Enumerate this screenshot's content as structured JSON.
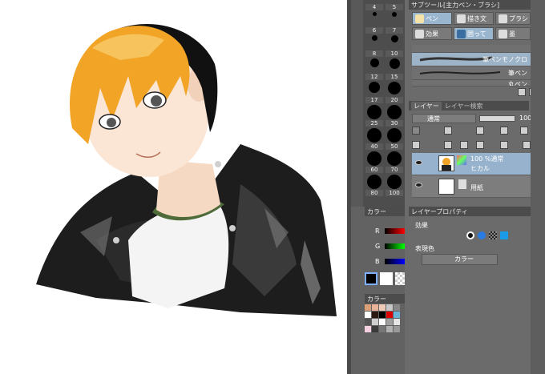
{
  "brush_sizes": [
    {
      "a": "4",
      "b": "5"
    },
    {
      "a": "6",
      "b": "7"
    },
    {
      "a": "8",
      "b": "10"
    },
    {
      "a": "12",
      "b": "15"
    },
    {
      "a": "17",
      "b": "20"
    },
    {
      "a": "25",
      "b": "30"
    },
    {
      "a": "40",
      "b": "50"
    },
    {
      "a": "60",
      "b": "70"
    },
    {
      "a": "80",
      "b": "100"
    }
  ],
  "subtool": {
    "header": "サブツール[主力ペン・ブラシ]",
    "tabs": [
      "ペン",
      "描き文",
      "ブラシ",
      "効果",
      "囲って",
      "墨"
    ],
    "strokes": [
      "筆ペンモノクロ",
      "筆ペン",
      "丸ペン"
    ]
  },
  "layer_panel": {
    "header_tab": "レイヤー",
    "header_tab2": "レイヤー検索",
    "blend_mode": "通常",
    "opacity": "100",
    "layers": [
      {
        "line1": "100 %通常",
        "line2": "ヒカル"
      },
      {
        "line1": "用紙",
        "line2": ""
      }
    ]
  },
  "color_panel": {
    "header": "カラー",
    "labels": [
      "R",
      "G",
      "B"
    ]
  },
  "color_set": {
    "header": "カラー"
  },
  "layer_property": {
    "header": "レイヤープロパティ",
    "effect_label": "効果",
    "express_label": "表現色",
    "express_value": "カラー"
  },
  "colors": {
    "panel": "#6b6b6b",
    "selected": "#9ab6cf",
    "dark": "#4c4c4c"
  }
}
